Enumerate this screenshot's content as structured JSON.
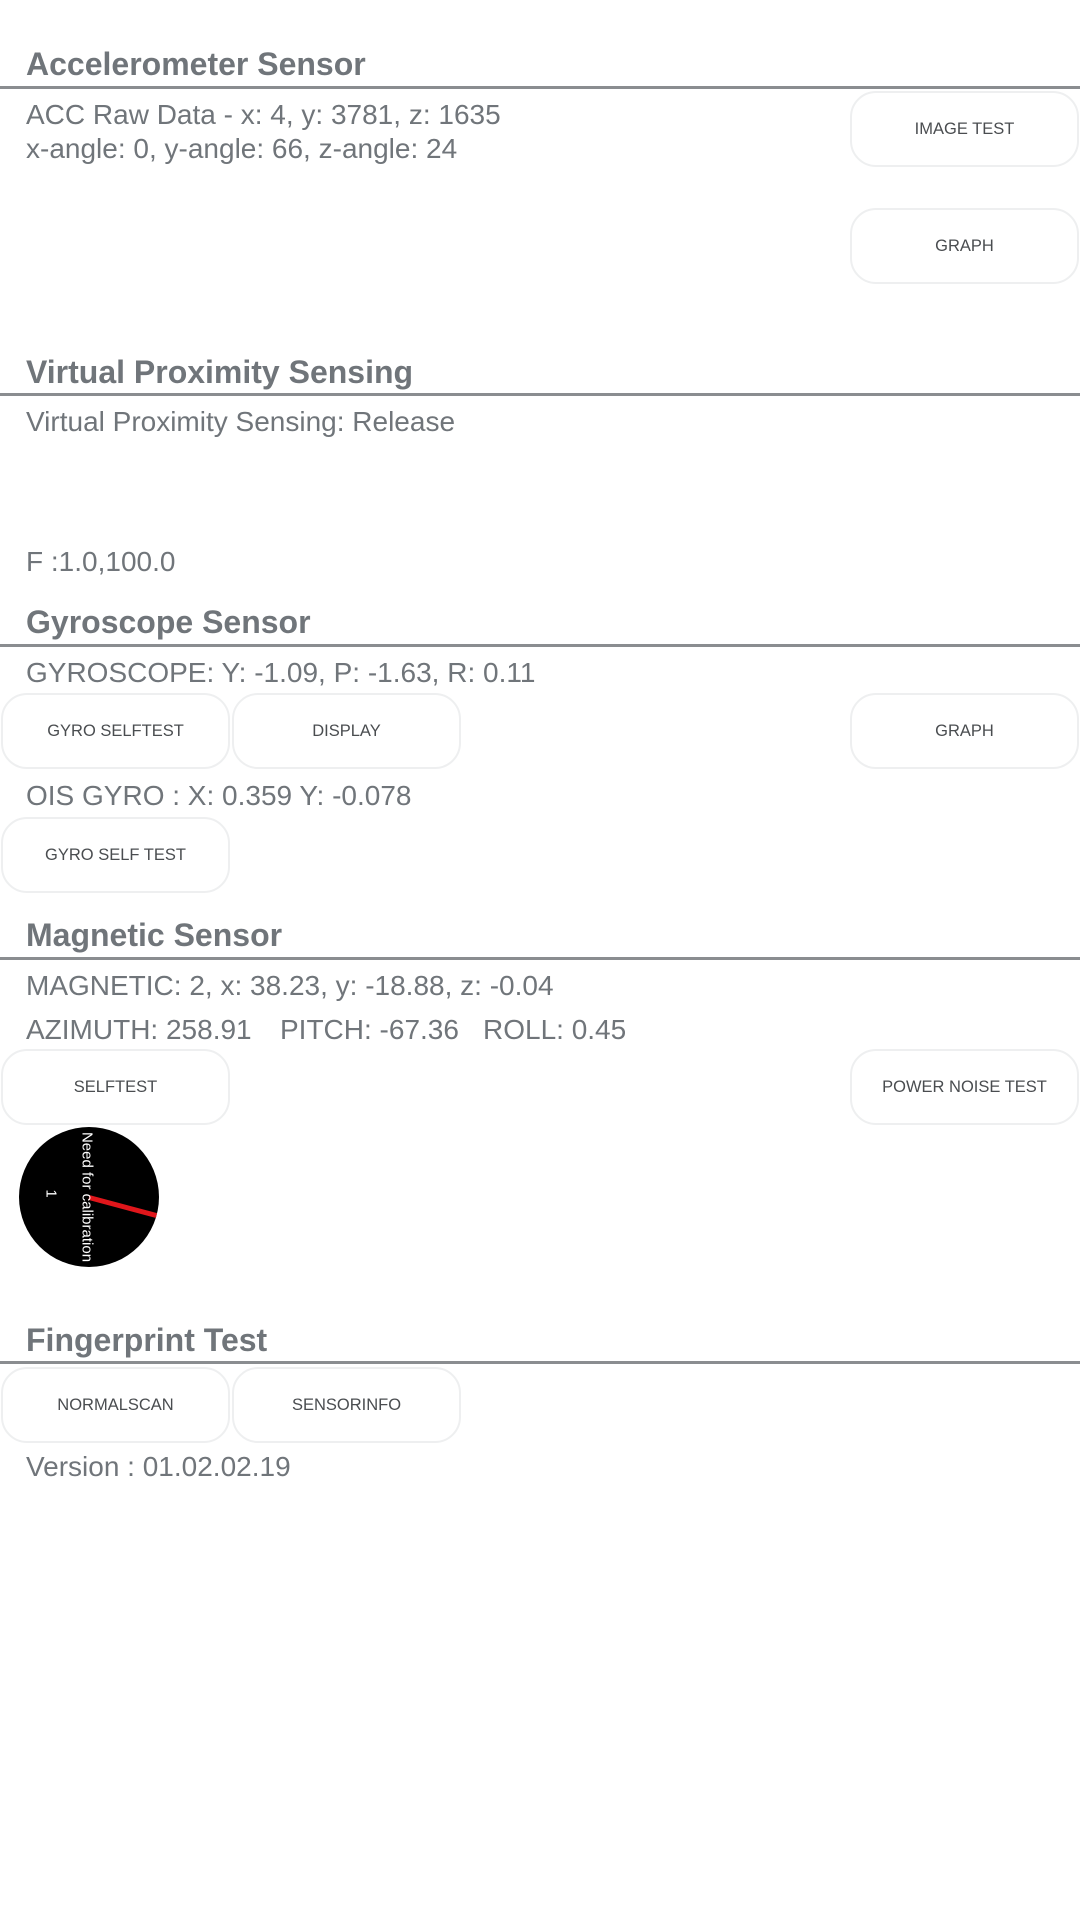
{
  "accelerometer": {
    "title": "Accelerometer Sensor",
    "raw": "ACC Raw Data - x: 4, y: 3781, z: 1635",
    "angles": "x-angle: 0, y-angle: 66, z-angle: 24",
    "image_test_label": "IMAGE TEST",
    "graph_label": "GRAPH"
  },
  "proximity": {
    "title": "Virtual Proximity Sensing",
    "status": "Virtual Proximity Sensing: Release",
    "f_value": "F :1.0,100.0"
  },
  "gyroscope": {
    "title": "Gyroscope Sensor",
    "values": "GYROSCOPE: Y: -1.09, P: -1.63, R: 0.11",
    "selftest_label": "GYRO SELFTEST",
    "display_label": "DISPLAY",
    "graph_label": "GRAPH",
    "ois": "OIS GYRO : X: 0.359 Y: -0.078",
    "ois_selftest_label": "GYRO SELF TEST"
  },
  "magnetic": {
    "title": "Magnetic Sensor",
    "values": "MAGNETIC: 2, x: 38.23, y: -18.88, z: -0.04",
    "azimuth": "AZIMUTH: 258.91",
    "pitch": "PITCH: -67.36",
    "roll": "ROLL: 0.45",
    "selftest_label": "SELFTEST",
    "power_noise_label": "POWER NOISE TEST",
    "compass": {
      "calibration_text": "Need for calibration",
      "accuracy": "1",
      "needle_color": "#e0161b"
    }
  },
  "fingerprint": {
    "title": "Fingerprint Test",
    "normalscan_label": "NORMALSCAN",
    "sensorinfo_label": "SENSORINFO",
    "version": "Version : 01.02.02.19"
  }
}
